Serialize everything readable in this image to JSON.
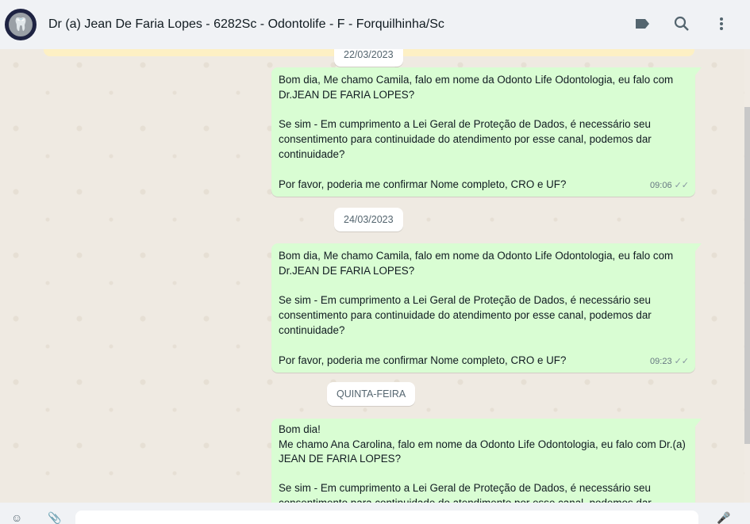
{
  "header": {
    "title": "Dr (a) Jean De Faria Lopes - 6282Sc - Odontolife - F - Forquilhinha/Sc",
    "icons": [
      "label-icon",
      "search-icon",
      "menu-icon"
    ]
  },
  "chat": {
    "date_pills": [
      "22/03/2023",
      "24/03/2023",
      "QUINTA-FEIRA"
    ],
    "messages": [
      {
        "text": "Bom dia, Me chamo Camila, falo em nome da Odonto Life Odontologia, eu falo com Dr.JEAN DE FARIA LOPES?\n\nSe sim - Em cumprimento a Lei Geral de Proteção de Dados, é necessário seu consentimento para continuidade do atendimento por esse canal, podemos dar continuidade?\n\nPor favor, poderia me confirmar Nome completo, CRO e UF?",
        "time": "09:06"
      },
      {
        "text": "Bom dia, Me chamo Camila, falo em nome da Odonto Life Odontologia, eu falo com Dr.JEAN DE FARIA LOPES?\n\nSe sim - Em cumprimento a Lei Geral de Proteção de Dados, é necessário seu consentimento para continuidade do atendimento por esse canal, podemos dar continuidade?\n\nPor favor, poderia me confirmar Nome completo, CRO e UF?",
        "time": "09:23"
      },
      {
        "text": "Bom dia!\nMe chamo Ana Carolina, falo em nome da Odonto Life Odontologia, eu falo com Dr.(a)  JEAN DE FARIA LOPES?\n\nSe sim - Em cumprimento a Lei Geral de Proteção de Dados, é necessário seu consentimento para continuidade do atendimento por esse canal, podemos dar continuidade?",
        "time": ""
      }
    ]
  },
  "colors": {
    "outgoing": "#d9fdd3",
    "background": "#efeae2",
    "header": "#f0f2f5"
  }
}
